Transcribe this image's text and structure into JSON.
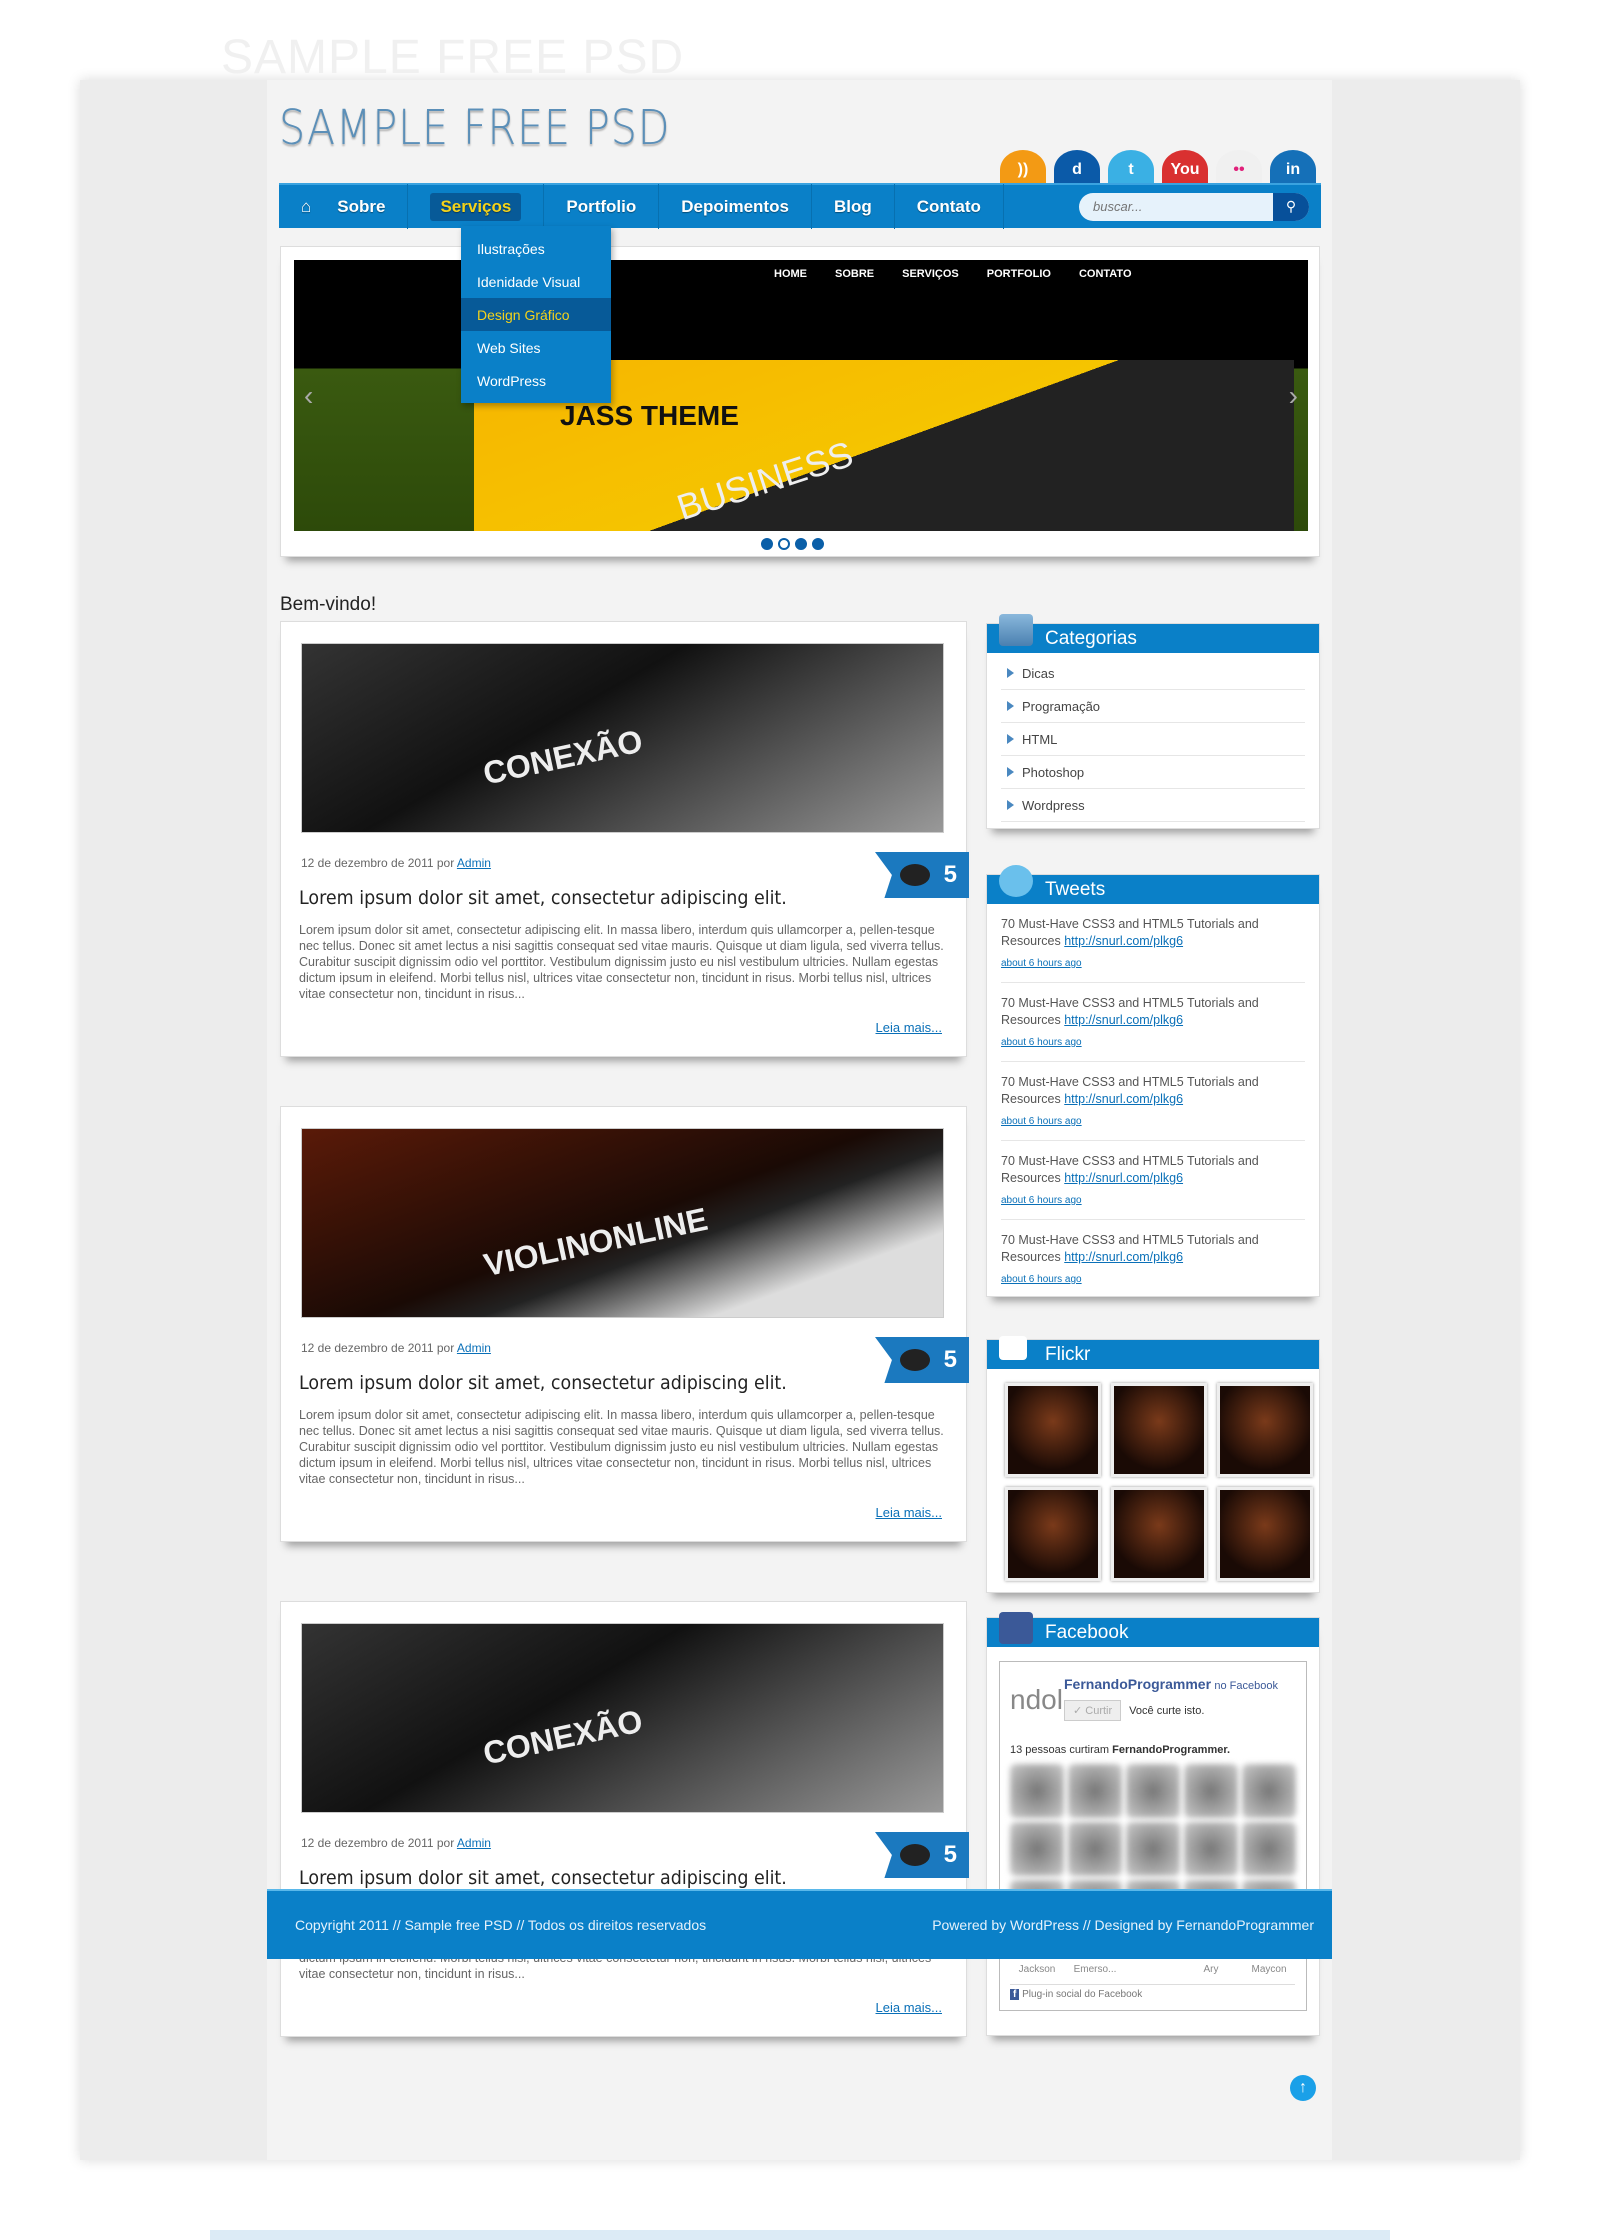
{
  "ghost_title": "SAMPLE FREE PSD",
  "logo": "SAMPLE FREE PSD",
  "social": [
    {
      "icon": "rss-icon",
      "glyph": "))",
      "color": "#f39a14"
    },
    {
      "icon": "delicious-icon",
      "glyph": "d",
      "color": "#0b5aa8"
    },
    {
      "icon": "twitter-icon",
      "glyph": "t",
      "color": "#3ab0e4"
    },
    {
      "icon": "youtube-icon",
      "glyph": "You",
      "color": "#d93030"
    },
    {
      "icon": "flickr-icon",
      "glyph": "••",
      "color": "#f0f0f0"
    },
    {
      "icon": "linkedin-icon",
      "glyph": "in",
      "color": "#1570b8"
    }
  ],
  "nav": {
    "items": [
      "Sobre",
      "Serviços",
      "Portfolio",
      "Depoimentos",
      "Blog",
      "Contato"
    ],
    "active": "Serviços",
    "search_placeholder": "buscar..."
  },
  "dropdown": {
    "items": [
      "Ilustrações",
      "Idenidade Visual",
      "Design Gráfico",
      "Web Sites",
      "WordPress"
    ],
    "active": "Design Gráfico"
  },
  "slider": {
    "nav": [
      "HOME",
      "SOBRE",
      "SERVIÇOS",
      "PORTFOLIO",
      "CONTATO"
    ],
    "brand": "JASS THEME",
    "headline": "BUSINESS",
    "slides": 4,
    "current": 1
  },
  "welcome": "Bem-vindo!",
  "posts": [
    {
      "image_text": "CONEXÃO",
      "date": "12 de dezembro de 2011 por",
      "author": "Admin",
      "comments": "5",
      "title": "Lorem ipsum dolor sit amet, consectetur adipiscing elit.",
      "body": "Lorem ipsum dolor sit amet, consectetur adipiscing elit. In massa libero, interdum quis ullamcorper a, pellen-tesque nec tellus. Donec sit amet lectus a nisi sagittis consequat sed vitae mauris. Quisque ut diam ligula, sed viverra tellus. Curabitur suscipit dignissim odio vel porttitor. Vestibulum dignissim justo eu nisl vestibulum ultricies. Nullam egestas dictum ipsum in eleifend. Morbi tellus nisl, ultrices vitae consectetur non, tincidunt in risus. Morbi tellus nisl, ultrices vitae consectetur non, tincidunt in risus...",
      "more": "Leia mais..."
    },
    {
      "image_text": "VIOLINONLINE",
      "date": "12 de dezembro de 2011 por",
      "author": "Admin",
      "comments": "5",
      "title": "Lorem ipsum dolor sit amet, consectetur adipiscing elit.",
      "body": "Lorem ipsum dolor sit amet, consectetur adipiscing elit. In massa libero, interdum quis ullamcorper a, pellen-tesque nec tellus. Donec sit amet lectus a nisi sagittis consequat sed vitae mauris. Quisque ut diam ligula, sed viverra tellus. Curabitur suscipit dignissim odio vel porttitor. Vestibulum dignissim justo eu nisl vestibulum ultricies. Nullam egestas dictum ipsum in eleifend. Morbi tellus nisl, ultrices vitae consectetur non, tincidunt in risus. Morbi tellus nisl, ultrices vitae consectetur non, tincidunt in risus...",
      "more": "Leia mais..."
    },
    {
      "image_text": "CONEXÃO",
      "date": "12 de dezembro de 2011 por",
      "author": "Admin",
      "comments": "5",
      "title": "Lorem ipsum dolor sit amet, consectetur adipiscing elit.",
      "body": "Lorem ipsum dolor sit amet, consectetur adipiscing elit. In massa libero, interdum quis ullamcorper a, pellen-tesque nec tellus. Donec sit amet lectus a nisi sagittis consequat sed vitae mauris. Quisque ut diam ligula, sed viverra tellus. Curabitur suscipit dignissim odio vel porttitor. Vestibulum dignissim justo eu nisl vestibulum ultricies. Nullam egestas dictum ipsum in eleifend. Morbi tellus nisl, ultrices vitae consectetur non, tincidunt in risus. Morbi tellus nisl, ultrices vitae consectetur non, tincidunt in risus...",
      "more": "Leia mais..."
    }
  ],
  "sidebar": {
    "categorias": {
      "title": "Categorias",
      "items": [
        "Dicas",
        "Programação",
        "HTML",
        "Photoshop",
        "Wordpress"
      ]
    },
    "tweets": {
      "title": "Tweets",
      "items": [
        {
          "text": "70 Must-Have CSS3 and HTML5 Tutorials and Resources",
          "link": "http://snurl.com/plkg6",
          "time": "about 6 hours ago"
        },
        {
          "text": "70 Must-Have CSS3 and HTML5 Tutorials and Resources",
          "link": "http://snurl.com/plkg6",
          "time": "about 6 hours ago"
        },
        {
          "text": "70 Must-Have CSS3 and HTML5 Tutorials and Resources",
          "link": "http://snurl.com/plkg6",
          "time": "about 6 hours ago"
        },
        {
          "text": "70 Must-Have CSS3 and HTML5 Tutorials and Resources",
          "link": "http://snurl.com/plkg6",
          "time": "about 6 hours ago"
        },
        {
          "text": "70 Must-Have CSS3 and HTML5 Tutorials and Resources",
          "link": "http://snurl.com/plkg6",
          "time": "about 6 hours ago"
        }
      ]
    },
    "flickr": {
      "title": "Flickr",
      "photos": 6
    },
    "facebook": {
      "title": "Facebook",
      "page": "FernandoProgrammer",
      "suffix": "no Facebook",
      "like_button": "✓ Curtir",
      "liked": "Você curte isto.",
      "count_text": "13 pessoas curtiram",
      "count_name": "FernandoProgrammer.",
      "names": [
        "Jackson",
        "Emerso...",
        "",
        "Ary",
        "Maycon"
      ],
      "plugin": "Plug-in social do Facebook"
    }
  },
  "footer": {
    "left": "Copyright 2011 // Sample free PSD // Todos os direitos reservados",
    "right": "Powered by WordPress // Designed by FernandoProgrammer"
  },
  "colors": {
    "accent": "#0a80c8",
    "highlight": "#f4d21a"
  }
}
